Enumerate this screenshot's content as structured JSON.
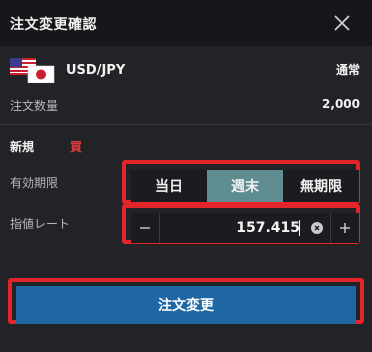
{
  "header": {
    "title": "注文変更確認",
    "close_icon": "close-icon"
  },
  "pair": {
    "flag_icons": [
      "us-flag-icon",
      "japan-flag-icon"
    ],
    "label": "USD/JPY",
    "order_type": "通常"
  },
  "quantity": {
    "label": "注文数量",
    "value": "2,000"
  },
  "order": {
    "new_label": "新規",
    "side_label": "買",
    "side_color": "#e0393e"
  },
  "validity": {
    "label": "有効期限",
    "options": [
      "当日",
      "週末",
      "無期限"
    ],
    "selected": "週末"
  },
  "rate": {
    "label": "指値レート",
    "value": "157.415",
    "minus_icon": "minus-icon",
    "plus_icon": "plus-icon",
    "clear_icon": "clear-icon"
  },
  "submit": {
    "label": "注文変更"
  },
  "colors": {
    "background": "#222326",
    "header_bg": "#16171a",
    "highlight_border": "#e3242b",
    "selected_segment": "#5e8c91",
    "primary_button": "#1e67a3"
  }
}
